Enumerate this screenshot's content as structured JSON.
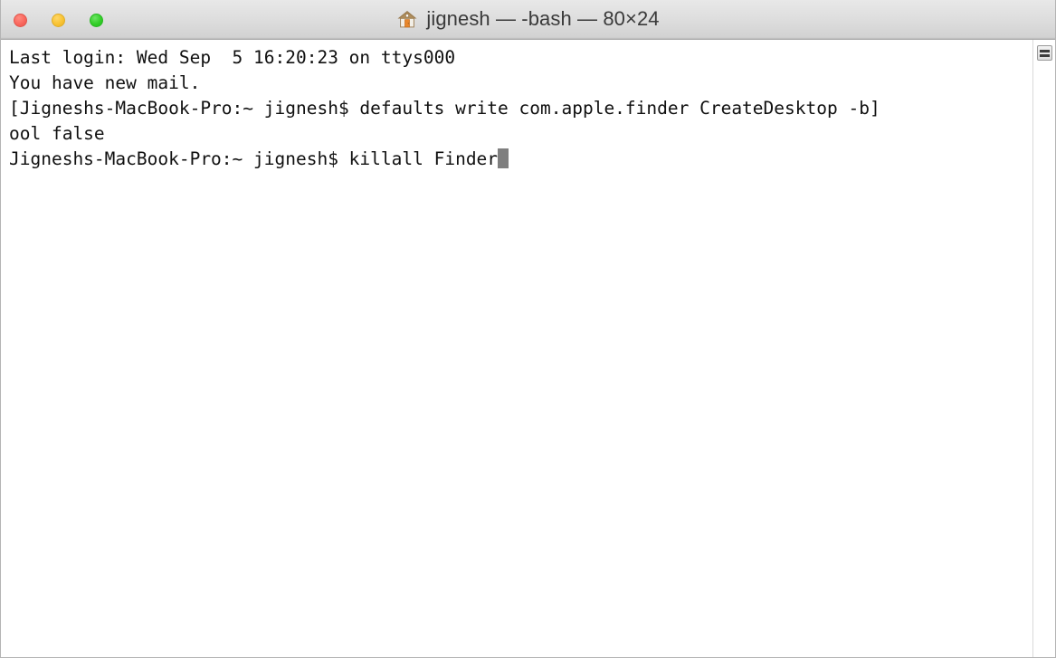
{
  "window": {
    "title": "jignesh — -bash — 80×24",
    "icon": "home-icon",
    "controls": {
      "close_label": "",
      "minimize_label": "",
      "zoom_label": ""
    },
    "colors": {
      "close": "#f9675d",
      "minimize": "#f8c333",
      "zoom": "#33ce28",
      "titlebar": "#dedede",
      "background": "#ffffff",
      "text": "#101010",
      "cursor": "#7f7f7f"
    }
  },
  "terminal": {
    "columns": 80,
    "rows": 24,
    "shell": "-bash",
    "lines": [
      "Last login: Wed Sep  5 16:20:23 on ttys000",
      "You have new mail.",
      "[Jigneshs-MacBook-Pro:~ jignesh$ defaults write com.apple.finder CreateDesktop -b]",
      "ool false",
      "Jigneshs-MacBook-Pro:~ jignesh$ killall Finder"
    ],
    "prompt": "Jigneshs-MacBook-Pro:~ jignesh$",
    "current_command": "killall Finder",
    "cursor_visible": true
  },
  "scrollbar": {
    "thumb_label": "scroll-thumb"
  }
}
